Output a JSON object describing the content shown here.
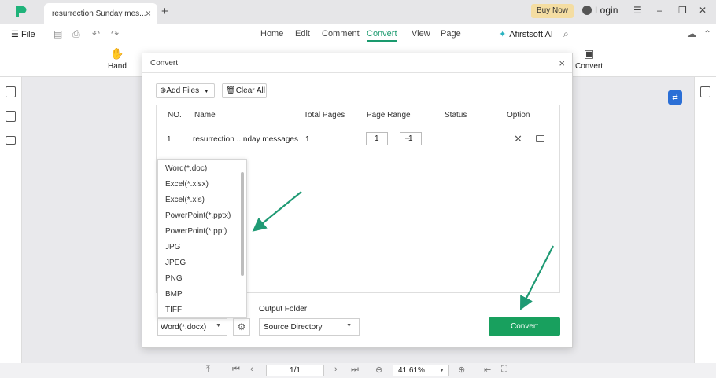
{
  "colors": {
    "accent": "#1a9a6e",
    "convert_button": "#18a05e",
    "buy_now_bg": "#f4dda2",
    "annotation_arrow": "#1f9a74"
  },
  "titlebar": {
    "tab_title": "resurrection Sunday mes...",
    "tab_close": "×",
    "new_tab": "+",
    "buy_now": "Buy Now",
    "login": "Login"
  },
  "menubar": {
    "file": "File",
    "items": [
      "Home",
      "Edit",
      "Comment",
      "Convert",
      "View",
      "Page"
    ],
    "active": "Convert",
    "ai": "Afirstsoft AI"
  },
  "toolbar": {
    "hand": "Hand",
    "convert_partial": "Convert"
  },
  "dialog": {
    "title": "Convert",
    "close": "×",
    "add_files": "Add Files",
    "clear_all": "Clear All",
    "columns": [
      "NO.",
      "Name",
      "Total Pages",
      "Page Range",
      "Status",
      "Option"
    ],
    "row": {
      "no": "1",
      "name": "resurrection ...nday messages",
      "total_pages": "1",
      "range_from": "1",
      "range_to": "1"
    },
    "format_options": [
      "Word(*.doc)",
      "Excel(*.xlsx)",
      "Excel(*.xls)",
      "PowerPoint(*.pptx)",
      "PowerPoint(*.ppt)",
      "JPG",
      "JPEG",
      "PNG",
      "BMP",
      "TIFF"
    ],
    "selected_format": "Word(*.docx)",
    "output_folder_label": "Output Folder",
    "output_folder_value": "Source Directory",
    "convert_button": "Convert"
  },
  "statusbar": {
    "page": "1/1",
    "zoom": "41.61%"
  }
}
